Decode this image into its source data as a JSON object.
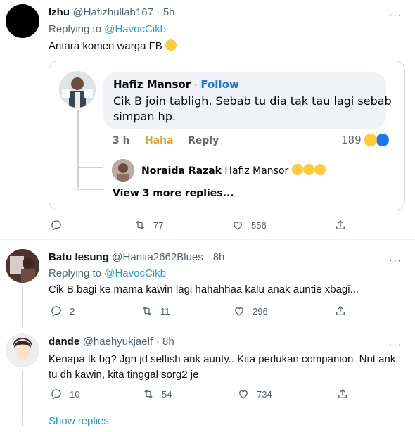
{
  "tweets": [
    {
      "name": "Izhu",
      "handle": "@Hafizhullah167",
      "time": "5h",
      "replying_prefix": "Replying to ",
      "replying_to": "@HavocCikb",
      "text": "Antara komen warga FB",
      "replies": "",
      "retweets": "77",
      "likes": "556"
    },
    {
      "name": "Batu lesung",
      "handle": "@Hanita2662Blues",
      "time": "8h",
      "replying_prefix": "Replying to ",
      "replying_to": "@HavocCikb",
      "text": "Cik B bagi ke mama kawin lagi hahahhaa kalu anak auntie xbagi...",
      "replies": "2",
      "retweets": "11",
      "likes": "296"
    },
    {
      "name": "dande",
      "handle": "@haehyukjaelf",
      "time": "8h",
      "text_line1": "Kenapa tk bg? Jgn jd selfish ank aunty.. Kita perlukan companion.  Nnt ank",
      "text_line2": "tu dh kawin, kita tinggal sorg2 je",
      "replies": "10",
      "retweets": "54",
      "likes": "734"
    }
  ],
  "fb_card": {
    "commenter": "Hafiz Mansor",
    "dot": "·",
    "follow": "Follow",
    "comment_line1": "Cik B join tabligh. Sebab tu dia tak tau lagi sebab",
    "comment_line2": "simpan hp.",
    "age": "3 h",
    "haha": "Haha",
    "reply": "Reply",
    "reaction_count": "189",
    "reply_author": "Noraida Razak",
    "reply_text": "Hafiz Mansor",
    "view_more": "View 3 more replies..."
  },
  "sep": "·",
  "show_replies": "Show replies",
  "colors": {
    "accent": "#1d9bf0",
    "muted": "#536471",
    "haha": "#e3a21a"
  }
}
